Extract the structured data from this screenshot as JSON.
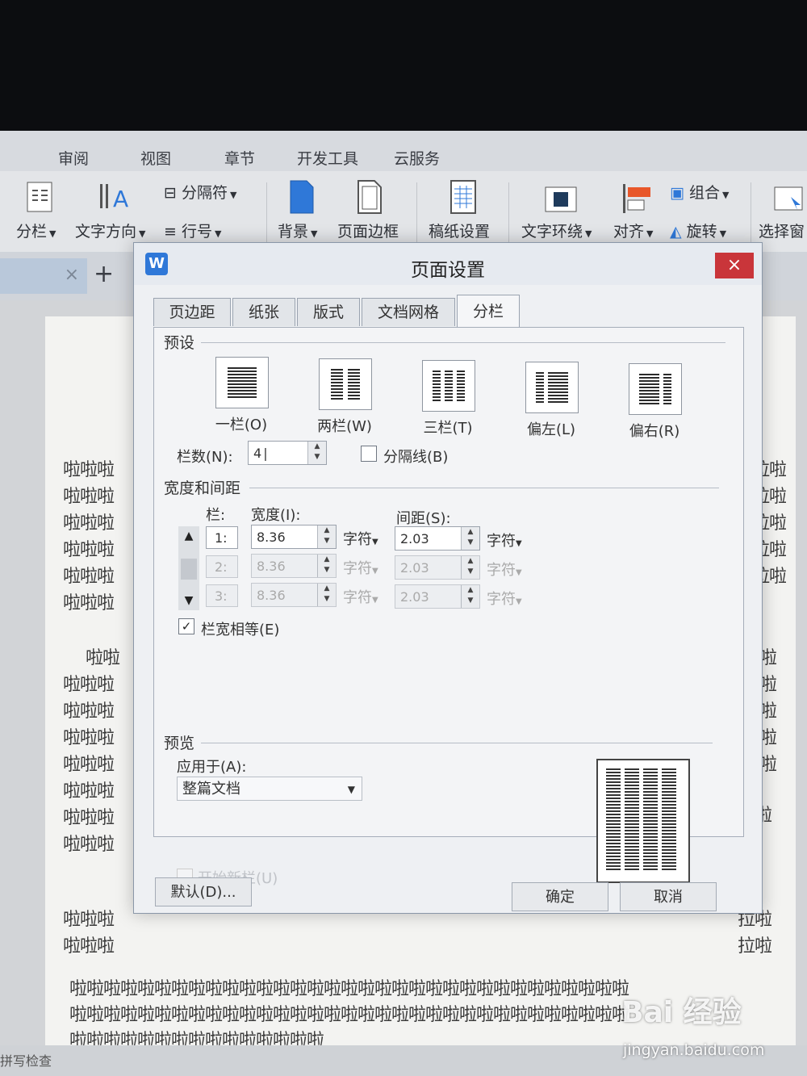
{
  "menu_tabs": [
    "审阅",
    "视图",
    "章节",
    "开发工具",
    "云服务"
  ],
  "ribbon": {
    "columns": "分栏",
    "text_direction": "文字方向",
    "section_break": "分隔符",
    "line_number": "行号",
    "background": "背景",
    "page_border": "页面边框",
    "manuscript_settings": "稿纸设置",
    "text_wrap": "文字环绕",
    "align": "对齐",
    "group": "组合",
    "rotate": "旋转",
    "selection_pane": "选择窗"
  },
  "doc_tab": {
    "close": "×",
    "new": "+"
  },
  "document": {
    "left_lines": [
      "啦啦啦",
      "啦啦啦",
      "啦啦啦",
      "啦啦啦",
      "啦啦啦",
      "啦啦啦",
      "啦啦",
      "啦啦啦",
      "啦啦啦",
      "啦啦啦",
      "啦啦啦",
      "啦啦啦",
      "啦啦啦",
      "啦啦啦",
      "啦啦啦",
      "啦啦啦"
    ],
    "right_lines": [
      "拉啦",
      "拉啦",
      "拉啦",
      "拉啦",
      "拉啦",
      "拉啦",
      "拉啦",
      "拉啦",
      "拉啦",
      "拉啦",
      "拉啦",
      "拉啦",
      "拉啦"
    ],
    "bottom_lines": [
      "啦啦啦啦啦啦啦啦啦啦啦啦啦啦啦啦啦啦啦啦啦啦啦啦啦啦啦啦啦啦啦啦啦",
      "啦啦啦啦啦啦啦啦啦啦啦啦啦啦啦啦啦啦啦啦啦啦啦啦啦啦啦啦啦啦啦啦啦",
      "啦啦啦啦啦啦啦啦啦啦啦啦啦啦啦"
    ],
    "status": "拼写检查"
  },
  "dialog": {
    "title": "页面设置",
    "logo": "W",
    "close": "×",
    "tabs": [
      "页边距",
      "纸张",
      "版式",
      "文档网格",
      "分栏"
    ],
    "active_tab": "分栏",
    "preset_title": "预设",
    "presets": [
      "一栏(O)",
      "两栏(W)",
      "三栏(T)",
      "偏左(L)",
      "偏右(R)"
    ],
    "columns_label": "栏数(N):",
    "columns_value": "4",
    "separator_label": "分隔线(B)",
    "separator_checked": false,
    "width_spacing_title": "宽度和间距",
    "col_header": "栏:",
    "width_header": "宽度(I):",
    "spacing_header": "间距(S):",
    "rows": [
      {
        "num": "1:",
        "width": "8.36",
        "width_unit": "字符",
        "spacing": "2.03",
        "spacing_unit": "字符"
      },
      {
        "num": "2:",
        "width": "8.36",
        "width_unit": "字符",
        "spacing": "2.03",
        "spacing_unit": "字符"
      },
      {
        "num": "3:",
        "width": "8.36",
        "width_unit": "字符",
        "spacing": "2.03",
        "spacing_unit": "字符"
      }
    ],
    "equal_width_label": "栏宽相等(E)",
    "equal_width_checked": true,
    "preview_title": "预览",
    "apply_to_label": "应用于(A):",
    "apply_to_value": "整篇文档",
    "new_column_label": "开始新栏(U)",
    "default_button": "默认(D)...",
    "ok_button": "确定",
    "cancel_button": "取消"
  },
  "watermark": {
    "brand": "Bai 经验",
    "url": "jingyan.baidu.com"
  }
}
